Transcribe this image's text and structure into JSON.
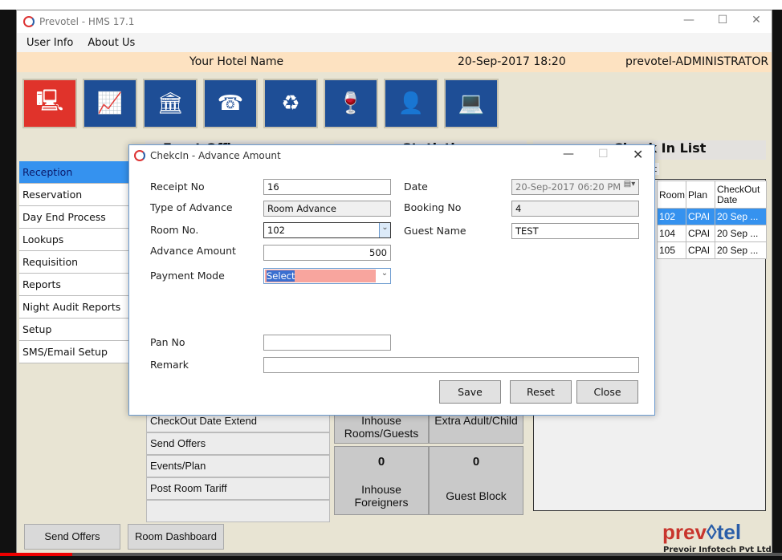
{
  "window": {
    "title": "Prevotel - HMS 17.1"
  },
  "menu": [
    "User Info",
    "About Us"
  ],
  "header": {
    "hotel_name": "Your Hotel Name",
    "datetime": "20-Sep-2017 18:20",
    "user": "prevotel-ADMINISTRATOR"
  },
  "tiles": [
    {
      "icon": "reception-desk-icon",
      "active": true
    },
    {
      "icon": "presentation-chart-icon"
    },
    {
      "icon": "bank-money-icon"
    },
    {
      "icon": "phone-book-icon"
    },
    {
      "icon": "cycle-chart-icon"
    },
    {
      "icon": "bar-wine-icon"
    },
    {
      "icon": "staff-icon"
    },
    {
      "icon": "laptop-tools-icon"
    }
  ],
  "sections": {
    "front_office": "Front Office",
    "statistics": "Statistics",
    "checkin_list": "Check In List",
    "list_tab": "List"
  },
  "sidebar": [
    "Reception",
    "Reservation",
    "Day End Process",
    "Lookups",
    "Requisition",
    "Reports",
    "Night Audit Reports",
    "Setup",
    "SMS/Email Setup"
  ],
  "front_office_items": [
    "CheckOut Date Extend",
    "Send Offers",
    "Events/Plan",
    "Post Room Tariff"
  ],
  "stats": [
    {
      "label": "Inhouse Rooms/Guests"
    },
    {
      "label": "Extra Adult/Child"
    },
    {
      "value": "0",
      "label": "Inhouse Foreigners"
    },
    {
      "value": "0",
      "label": "Guest Block"
    }
  ],
  "checkin_table": {
    "headers": [
      "Room",
      "Plan",
      "CheckOut Date"
    ],
    "rows": [
      [
        "102",
        "CPAI",
        "20 Sep ..."
      ],
      [
        "104",
        "CPAI",
        "20 Sep ..."
      ],
      [
        "105",
        "CPAI",
        "20 Sep ..."
      ]
    ]
  },
  "bottom_buttons": [
    "Send Offers",
    "Room Dashboard"
  ],
  "brand": {
    "logo": "prevotel",
    "company": "Prevoir Infotech Pvt Ltd"
  },
  "dialog": {
    "title": "ChekcIn - Advance Amount",
    "receipt_no_label": "Receipt No",
    "receipt_no": "16",
    "type_label": "Type of Advance",
    "type": "Room Advance",
    "room_label": "Room No.",
    "room": "102",
    "amount_label": "Advance Amount",
    "amount": "500",
    "payment_label": "Payment Mode",
    "payment": "Select",
    "date_label": "Date",
    "date": "20-Sep-2017 06:20 PM",
    "booking_label": "Booking No",
    "booking": "4",
    "guest_label": "Guest Name",
    "guest": "TEST",
    "pan_label": "Pan No",
    "pan": "",
    "remark_label": "Remark",
    "remark": "",
    "save": "Save",
    "reset": "Reset",
    "close": "Close"
  }
}
